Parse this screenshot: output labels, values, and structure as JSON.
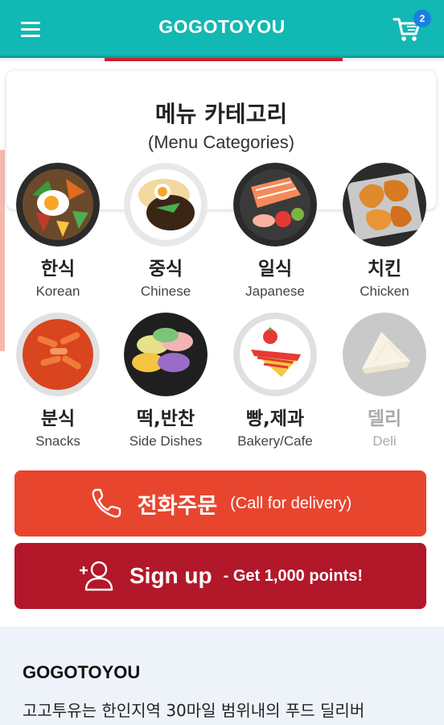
{
  "header": {
    "title": "GOGOTOYOU",
    "cart_count": "2",
    "menu_icon": "hamburger-icon",
    "cart_icon": "cart-icon",
    "accent_color": "#12b8b3"
  },
  "categories_card": {
    "title": "메뉴 카테고리",
    "subtitle": "(Menu Categories)"
  },
  "categories": [
    {
      "ko": "한식",
      "en": "Korean",
      "icon": "bibimbap-icon"
    },
    {
      "ko": "중식",
      "en": "Chinese",
      "icon": "jajangmyeon-icon"
    },
    {
      "ko": "일식",
      "en": "Japanese",
      "icon": "sashimi-icon"
    },
    {
      "ko": "치킨",
      "en": "Chicken",
      "icon": "fried-chicken-icon"
    },
    {
      "ko": "분식",
      "en": "Snacks",
      "icon": "tteokbokki-icon"
    },
    {
      "ko": "떡,반찬",
      "en": "Side Dishes",
      "icon": "rice-cake-icon"
    },
    {
      "ko": "빵,제과",
      "en": "Bakery/Cafe",
      "icon": "cake-icon"
    },
    {
      "ko": "델리",
      "en": "Deli",
      "icon": "sandwich-icon",
      "state": "disabled"
    }
  ],
  "cta": {
    "call": {
      "main": "전화주문",
      "sub": "(Call for delivery)",
      "icon": "phone-icon",
      "color": "#e8452f"
    },
    "signup": {
      "main": "Sign up",
      "sub": "- Get 1,000 points!",
      "icon": "add-user-icon",
      "color": "#b3172a"
    }
  },
  "about": {
    "title": "GOGOTOYOU",
    "text": "고고투유는 한인지역 30마일 범위내의 푸드 딜리버"
  }
}
